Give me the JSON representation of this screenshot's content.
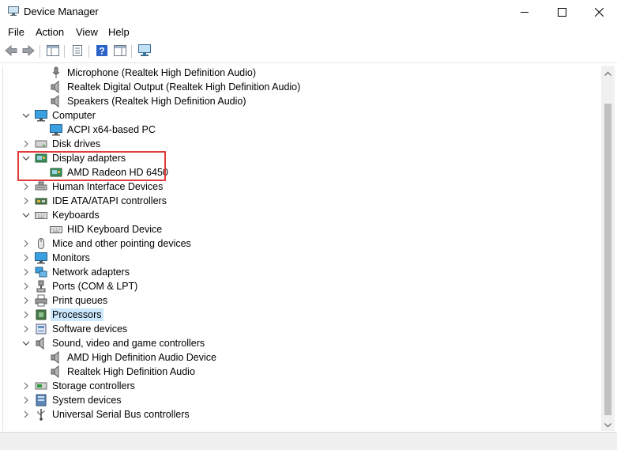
{
  "window": {
    "title": "Device Manager"
  },
  "menu": [
    "File",
    "Action",
    "View",
    "Help"
  ],
  "tree": [
    {
      "label": "Microphone (Realtek High Definition Audio)",
      "level": 1,
      "icon": "microphone-icon"
    },
    {
      "label": "Realtek Digital Output (Realtek High Definition Audio)",
      "level": 1,
      "icon": "speaker-icon"
    },
    {
      "label": "Speakers (Realtek High Definition Audio)",
      "level": 1,
      "icon": "speaker-icon"
    },
    {
      "label": "Computer",
      "level": 0,
      "icon": "monitor-icon",
      "expanded": true
    },
    {
      "label": "ACPI x64-based PC",
      "level": 1,
      "icon": "monitor-icon"
    },
    {
      "label": "Disk drives",
      "level": 0,
      "icon": "disk-drive-icon",
      "expanded": false
    },
    {
      "label": "Display adapters",
      "level": 0,
      "icon": "display-adapter-icon",
      "expanded": true
    },
    {
      "label": "AMD Radeon HD 6450",
      "level": 1,
      "icon": "display-adapter-icon"
    },
    {
      "label": "Human Interface Devices",
      "level": 0,
      "icon": "hid-icon",
      "expanded": false
    },
    {
      "label": "IDE ATA/ATAPI controllers",
      "level": 0,
      "icon": "ide-controller-icon",
      "expanded": false
    },
    {
      "label": "Keyboards",
      "level": 0,
      "icon": "keyboard-icon",
      "expanded": true
    },
    {
      "label": "HID Keyboard Device",
      "level": 1,
      "icon": "keyboard-icon"
    },
    {
      "label": "Mice and other pointing devices",
      "level": 0,
      "icon": "mouse-icon",
      "expanded": false
    },
    {
      "label": "Monitors",
      "level": 0,
      "icon": "monitor-icon",
      "expanded": false
    },
    {
      "label": "Network adapters",
      "level": 0,
      "icon": "network-icon",
      "expanded": false
    },
    {
      "label": "Ports (COM & LPT)",
      "level": 0,
      "icon": "port-icon",
      "expanded": false
    },
    {
      "label": "Print queues",
      "level": 0,
      "icon": "printer-icon",
      "expanded": false
    },
    {
      "label": "Processors",
      "level": 0,
      "icon": "processor-icon",
      "expanded": false,
      "selected": true
    },
    {
      "label": "Software devices",
      "level": 0,
      "icon": "software-device-icon",
      "expanded": false
    },
    {
      "label": "Sound, video and game controllers",
      "level": 0,
      "icon": "speaker-icon",
      "expanded": true
    },
    {
      "label": "AMD High Definition Audio Device",
      "level": 1,
      "icon": "speaker-icon"
    },
    {
      "label": "Realtek High Definition Audio",
      "level": 1,
      "icon": "speaker-icon"
    },
    {
      "label": "Storage controllers",
      "level": 0,
      "icon": "storage-icon",
      "expanded": false
    },
    {
      "label": "System devices",
      "level": 0,
      "icon": "system-device-icon",
      "expanded": false
    },
    {
      "label": "Universal Serial Bus controllers",
      "level": 0,
      "icon": "usb-icon",
      "expanded": false
    }
  ],
  "colors": {
    "highlight_box": "#e03c3c",
    "selection": "#cce8ff"
  }
}
